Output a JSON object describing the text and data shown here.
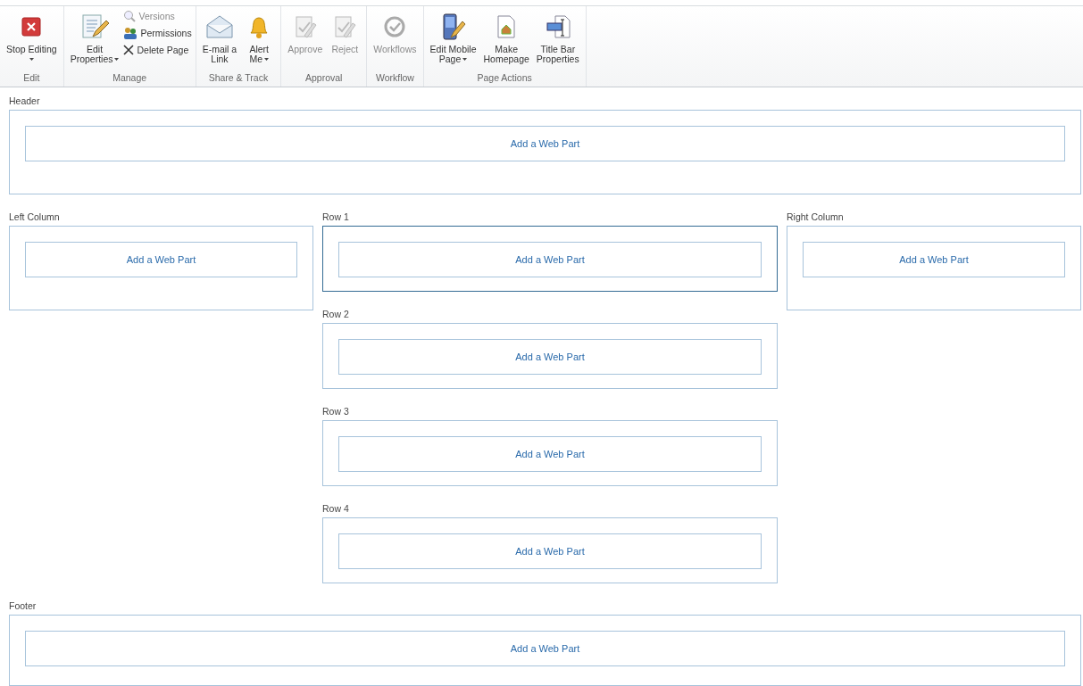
{
  "ribbon": {
    "groups": [
      {
        "label": "Edit",
        "buttons": [
          {
            "kind": "large",
            "lines": [
              "Stop Editing"
            ],
            "dropdown": true,
            "disabled": false
          }
        ]
      },
      {
        "label": "Manage",
        "buttons": [
          {
            "kind": "large",
            "lines": [
              "Edit",
              "Properties"
            ],
            "dropdown": true,
            "disabled": false
          },
          {
            "kind": "small",
            "lines": [
              "Versions"
            ],
            "dropdown": false,
            "disabled": true
          },
          {
            "kind": "small",
            "lines": [
              "Permissions"
            ],
            "dropdown": false,
            "disabled": false
          },
          {
            "kind": "small",
            "lines": [
              "Delete Page"
            ],
            "dropdown": false,
            "disabled": false
          }
        ]
      },
      {
        "label": "Share & Track",
        "buttons": [
          {
            "kind": "large",
            "lines": [
              "E-mail a",
              "Link"
            ],
            "dropdown": false,
            "disabled": false
          },
          {
            "kind": "large",
            "lines": [
              "Alert",
              "Me"
            ],
            "dropdown": true,
            "disabled": false
          }
        ]
      },
      {
        "label": "Approval",
        "buttons": [
          {
            "kind": "large",
            "lines": [
              "Approve"
            ],
            "dropdown": false,
            "disabled": true
          },
          {
            "kind": "large",
            "lines": [
              "Reject"
            ],
            "dropdown": false,
            "disabled": true
          }
        ]
      },
      {
        "label": "Workflow",
        "buttons": [
          {
            "kind": "large",
            "lines": [
              "Workflows"
            ],
            "dropdown": false,
            "disabled": true
          }
        ]
      },
      {
        "label": "Page Actions",
        "buttons": [
          {
            "kind": "large",
            "lines": [
              "Edit Mobile",
              "Page"
            ],
            "dropdown": true,
            "disabled": false
          },
          {
            "kind": "large",
            "lines": [
              "Make",
              "Homepage"
            ],
            "dropdown": false,
            "disabled": false
          },
          {
            "kind": "large",
            "lines": [
              "Title Bar",
              "Properties"
            ],
            "dropdown": false,
            "disabled": false
          }
        ]
      }
    ]
  },
  "zones": {
    "header": {
      "label": "Header",
      "web_part": "Add a Web Part",
      "selected": false
    },
    "left": {
      "label": "Left Column",
      "web_part": "Add a Web Part",
      "selected": false
    },
    "center": [
      {
        "label": "Row 1",
        "web_part": "Add a Web Part",
        "selected": true
      },
      {
        "label": "Row 2",
        "web_part": "Add a Web Part",
        "selected": false
      },
      {
        "label": "Row 3",
        "web_part": "Add a Web Part",
        "selected": false
      },
      {
        "label": "Row 4",
        "web_part": "Add a Web Part",
        "selected": false
      }
    ],
    "right": {
      "label": "Right Column",
      "web_part": "Add a Web Part",
      "selected": false
    },
    "footer": {
      "label": "Footer",
      "web_part": "Add a Web Part",
      "selected": false
    }
  }
}
